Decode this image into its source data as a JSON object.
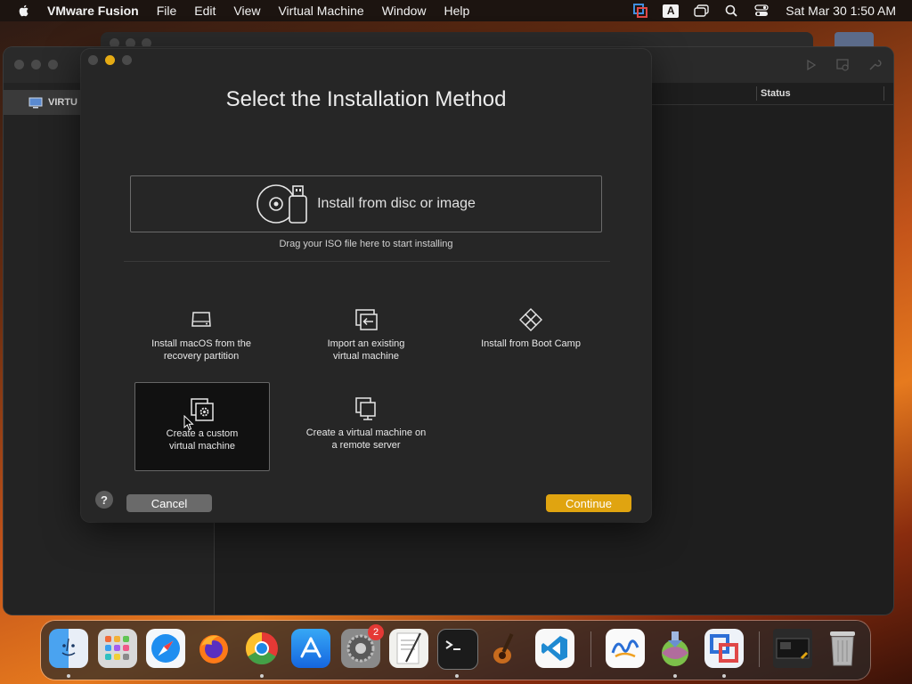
{
  "menubar": {
    "app_name": "VMware Fusion",
    "items": [
      "File",
      "Edit",
      "View",
      "Virtual Machine",
      "Window",
      "Help"
    ],
    "input_source": "A",
    "clock": "Sat Mar 30  1:50 AM"
  },
  "library_window": {
    "sidebar_item": "VIRTU",
    "column_status": "Status"
  },
  "dialog": {
    "title": "Select the Installation Method",
    "disc_option": "Install from disc or image",
    "disc_hint": "Drag your ISO file here to start installing",
    "options": [
      {
        "label": "Install macOS from the recovery partition",
        "line1": "Install macOS from the",
        "line2": "recovery partition",
        "icon": "drive-icon"
      },
      {
        "label": "Import an existing virtual machine",
        "line1": "Import an existing",
        "line2": "virtual machine",
        "icon": "import-icon"
      },
      {
        "label": "Install from Boot Camp",
        "line1": "Install from Boot Camp",
        "line2": "",
        "icon": "bootcamp-icon"
      },
      {
        "label": "Create a custom virtual machine",
        "line1": "Create a custom",
        "line2": "virtual machine",
        "icon": "custom-vm-icon",
        "selected": true
      },
      {
        "label": "Create a virtual machine on a remote server",
        "line1": "Create a virtual machine on",
        "line2": "a remote server",
        "icon": "remote-server-icon"
      }
    ],
    "help_label": "?",
    "cancel_label": "Cancel",
    "continue_label": "Continue"
  },
  "dock": {
    "settings_badge": "2",
    "apps": [
      "Finder",
      "Launchpad",
      "Safari",
      "Firefox",
      "Chrome",
      "App Store",
      "System Settings",
      "TextEdit",
      "Terminal",
      "GarageBand",
      "VS Code",
      "Freeform",
      "macOS Installer",
      "VMware Fusion",
      "Downloads",
      "Trash"
    ]
  },
  "colors": {
    "accent": "#e0a410",
    "dialog_bg": "#262626",
    "selected_bg": "#111111"
  }
}
